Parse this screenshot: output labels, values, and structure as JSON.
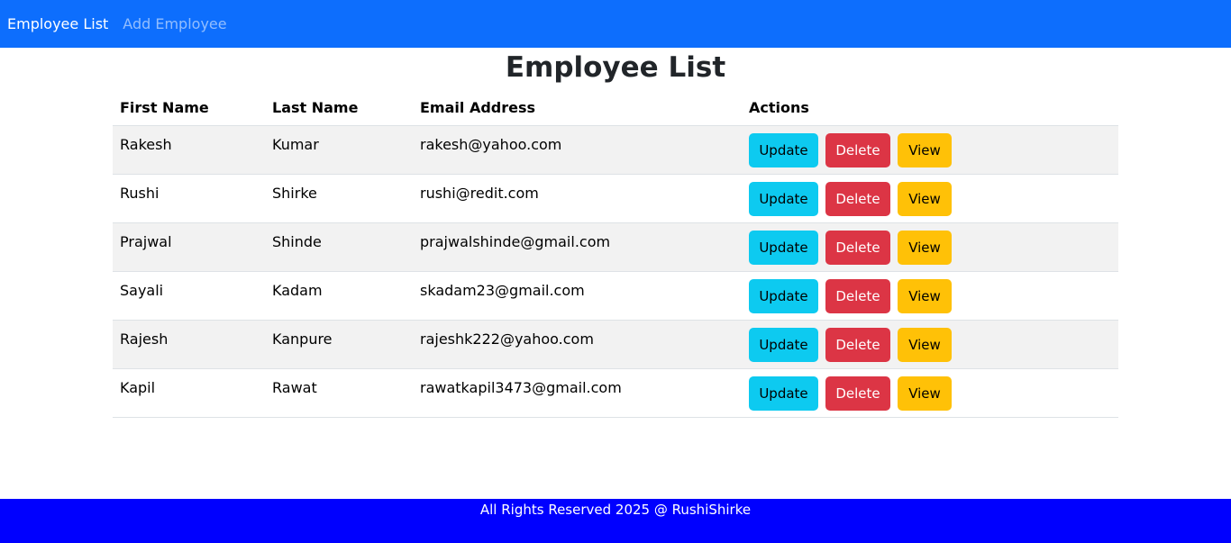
{
  "navbar": {
    "brand": "Employee List",
    "link": "Add Employee"
  },
  "page": {
    "title": "Employee List"
  },
  "table": {
    "headers": [
      "First Name",
      "Last Name",
      "Email Address",
      "Actions"
    ],
    "rows": [
      {
        "first_name": "Rakesh",
        "last_name": "Kumar",
        "email": "rakesh@yahoo.com"
      },
      {
        "first_name": "Rushi",
        "last_name": "Shirke",
        "email": "rushi@redit.com"
      },
      {
        "first_name": "Prajwal",
        "last_name": "Shinde",
        "email": "prajwalshinde@gmail.com"
      },
      {
        "first_name": "Sayali",
        "last_name": "Kadam",
        "email": "skadam23@gmail.com"
      },
      {
        "first_name": "Rajesh",
        "last_name": "Kanpure",
        "email": "rajeshk222@yahoo.com"
      },
      {
        "first_name": "Kapil",
        "last_name": "Rawat",
        "email": "rawatkapil3473@gmail.com"
      }
    ],
    "actions": {
      "update": "Update",
      "delete": "Delete",
      "view": "View"
    }
  },
  "footer": {
    "text": "All Rights Reserved 2025 @ RushiShirke"
  },
  "colors": {
    "navbar": "#0d6efd",
    "footer": "#0000ff",
    "update_button": "#0dcaf0",
    "delete_button": "#dc3545",
    "view_button": "#ffc107",
    "striped_row": "#f2f2f2"
  }
}
